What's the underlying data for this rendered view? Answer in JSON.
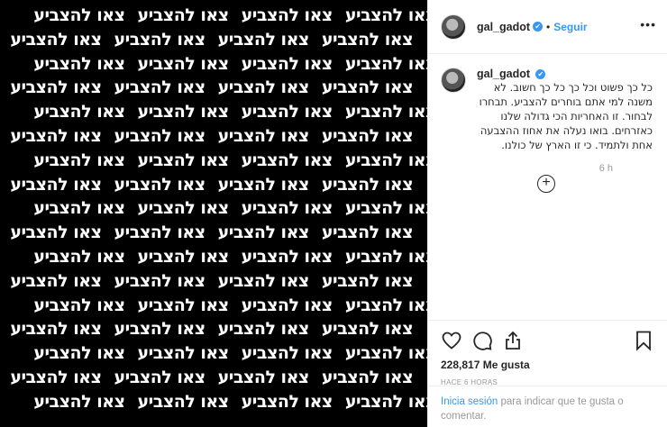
{
  "image": {
    "pattern_text": "צאו להצביע",
    "rows": 17,
    "per_row": 4
  },
  "header": {
    "username": "gal_gadot",
    "verified_badge": "✔",
    "separator": "•",
    "follow_label": "Seguir",
    "more_label": "•••"
  },
  "caption": {
    "username": "gal_gadot",
    "text": "כל כך פשוט וכל כך כל כך חשוב. לא משנה למי אתם בוחרים להצביע. תבחרו לבחור. זו האחריות הכי גדולה שלנו כאזרחים. בואו נעלה את אחוז ההצבעה אחת ולתמיד. כי זו הארץ של כולנו.",
    "time_ago": "6 h"
  },
  "load_more_icon": "+",
  "actions": {
    "likes": "228,817 Me gusta",
    "posted": "HACE 6 HORAS"
  },
  "login": {
    "link": "Inicia sesión",
    "rest": " para indicar que te gusta o comentar."
  },
  "icons": [
    "heart-icon",
    "comment-icon",
    "share-icon",
    "bookmark-icon"
  ]
}
